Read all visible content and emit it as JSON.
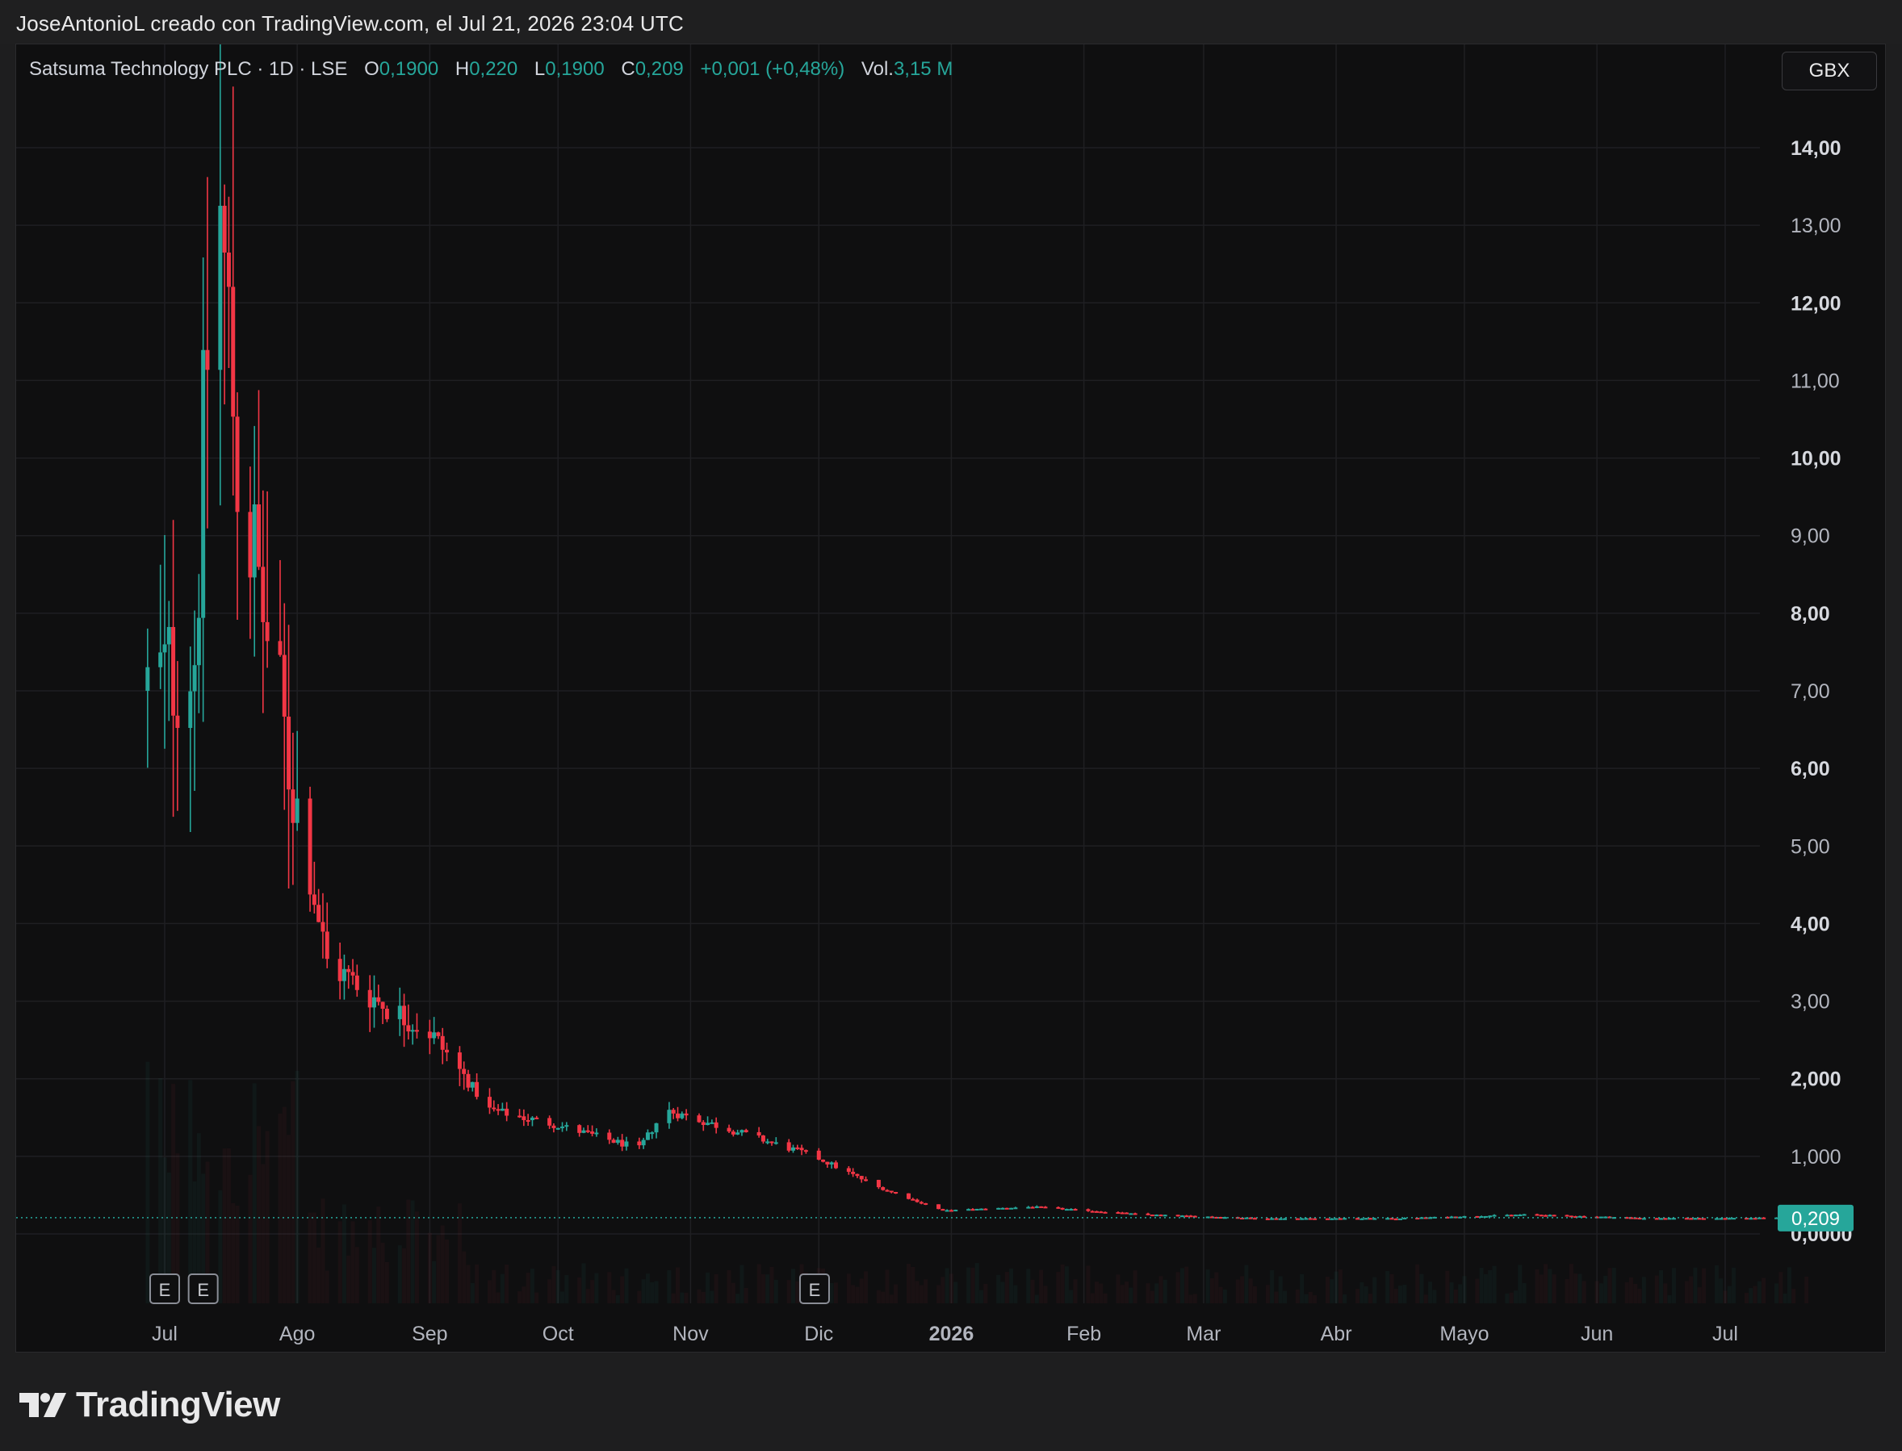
{
  "header": {
    "credit": "JoseAntonioL creado con TradingView.com, el Jul 21, 2026 23:04 UTC"
  },
  "legend": {
    "symbol": "Satsuma Technology PLC · 1D · LSE",
    "open_label": "O",
    "open": "0,1900",
    "high_label": "H",
    "high": "0,220",
    "low_label": "L",
    "low": "0,1900",
    "close_label": "C",
    "close": "0,209",
    "change": "+0,001 (+0,48%)",
    "vol_label": "Vol.",
    "vol": "3,15 M"
  },
  "currency": "GBX",
  "brand": {
    "name": "TradingView"
  },
  "colors": {
    "up": "#26a69a",
    "down": "#f23645",
    "grid": "#1f1f22",
    "axis_text": "#b2b5be",
    "price_tag": "#26a69a"
  },
  "chart_data": {
    "type": "candlestick",
    "x_tick_labels": [
      "Jul",
      "Ago",
      "Sep",
      "Oct",
      "Nov",
      "Dic",
      "2026",
      "Feb",
      "Mar",
      "Abr",
      "Mayo",
      "Jun",
      "Jul"
    ],
    "y_tick_labels": [
      "14,00",
      "13,00",
      "12,00",
      "11,00",
      "10,00",
      "9,00",
      "8,00",
      "7,00",
      "6,00",
      "5,00",
      "4,00",
      "3,00",
      "2,000",
      "1,000",
      "0,0000"
    ],
    "y_tick_values": [
      14,
      13,
      12,
      11,
      10,
      9,
      8,
      7,
      6,
      5,
      4,
      3,
      2,
      1,
      0
    ],
    "ylim": [
      0,
      14
    ],
    "last_price": 0.209,
    "last_price_label": "0,209",
    "events": [
      {
        "label": "E",
        "date": "2025-07-01"
      },
      {
        "label": "E",
        "date": "2025-07-10"
      },
      {
        "label": "E",
        "date": "2025-11-30"
      }
    ],
    "key_points": [
      {
        "date": "2025-06-27",
        "price": 7.0
      },
      {
        "date": "2025-07-08",
        "price": 7.5
      },
      {
        "date": "2025-07-13",
        "price": 13.9
      },
      {
        "date": "2025-07-18",
        "price": 10.0
      },
      {
        "date": "2025-07-27",
        "price": 7.0
      },
      {
        "date": "2025-08-01",
        "price": 5.5
      },
      {
        "date": "2025-08-08",
        "price": 3.5
      },
      {
        "date": "2025-08-20",
        "price": 3.0
      },
      {
        "date": "2025-09-01",
        "price": 2.6
      },
      {
        "date": "2025-09-15",
        "price": 1.6
      },
      {
        "date": "2025-10-01",
        "price": 1.4
      },
      {
        "date": "2025-10-20",
        "price": 1.1
      },
      {
        "date": "2025-10-26",
        "price": 1.6
      },
      {
        "date": "2025-11-10",
        "price": 1.35
      },
      {
        "date": "2025-11-30",
        "price": 1.0
      },
      {
        "date": "2025-12-15",
        "price": 0.6
      },
      {
        "date": "2025-12-30",
        "price": 0.3
      },
      {
        "date": "2026-01-20",
        "price": 0.35
      },
      {
        "date": "2026-02-15",
        "price": 0.25
      },
      {
        "date": "2026-03-15",
        "price": 0.2
      },
      {
        "date": "2026-04-15",
        "price": 0.2
      },
      {
        "date": "2026-05-15",
        "price": 0.25
      },
      {
        "date": "2026-06-15",
        "price": 0.2
      },
      {
        "date": "2026-07-20",
        "price": 0.209
      }
    ]
  }
}
